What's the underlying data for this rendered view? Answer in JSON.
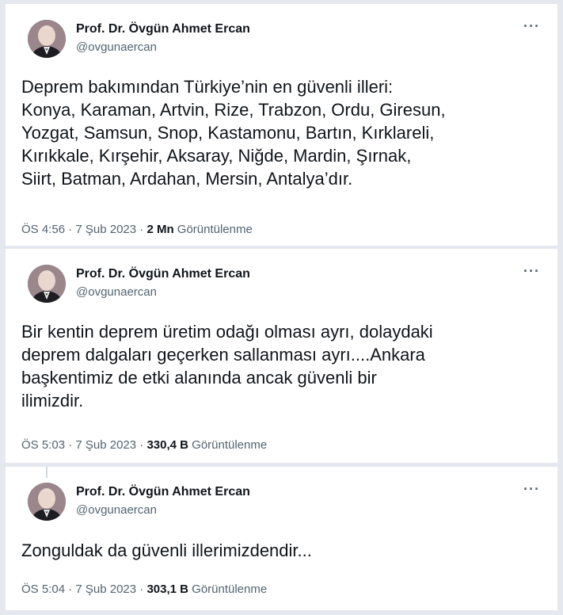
{
  "tweets": [
    {
      "author_name": "Prof. Dr. Övgün Ahmet Ercan",
      "handle": "@ovgunaercan",
      "more_icon": "···",
      "text": "Deprem bakımından Türkiye’nin en güvenli illeri:\nKonya, Karaman, Artvin, Rize, Trabzon, Ordu, Giresun,\nYozgat, Samsun, Snop, Kastamonu, Bartın, Kırklareli,\nKırıkkale, Kırşehir, Aksaray, Niğde, Mardin, Şırnak,\nSiirt, Batman, Ardahan, Mersin, Antalya’dır.",
      "time": "ÖS 4:56 · 7 Şub 2023 · ",
      "views": "2 Mn",
      "views_label": " Görüntülenme"
    },
    {
      "author_name": "Prof. Dr. Övgün Ahmet Ercan",
      "handle": "@ovgunaercan",
      "more_icon": "···",
      "text": "Bir kentin deprem üretim odağı olması ayrı, dolaydaki\ndeprem dalgaları geçerken sallanması ayrı....Ankara\nbaşkentimiz de etki alanında ancak güvenli bir\nilimizdir.",
      "time": "ÖS 5:03 · 7 Şub 2023 · ",
      "views": "330,4 B",
      "views_label": " Görüntülenme"
    },
    {
      "author_name": "Prof. Dr. Övgün Ahmet Ercan",
      "handle": "@ovgunaercan",
      "more_icon": "···",
      "text": "Zonguldak da güvenli illerimizdendir...",
      "time": "ÖS 5:04 · 7 Şub 2023 · ",
      "views": "303,1 B",
      "views_label": " Görüntülenme"
    }
  ]
}
